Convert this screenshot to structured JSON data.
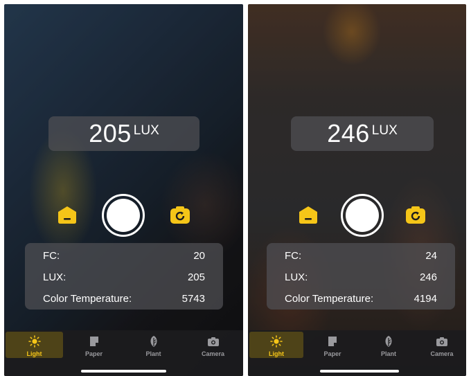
{
  "screens": [
    {
      "lux_display": {
        "value": "205",
        "unit": "LUX"
      },
      "stats": {
        "fc": {
          "label": "FC:",
          "value": "20"
        },
        "lux": {
          "label": "LUX:",
          "value": "205"
        },
        "color_temp": {
          "label": "Color Temperature:",
          "value": "5743"
        }
      }
    },
    {
      "lux_display": {
        "value": "246",
        "unit": "LUX"
      },
      "stats": {
        "fc": {
          "label": "FC:",
          "value": "24"
        },
        "lux": {
          "label": "LUX:",
          "value": "246"
        },
        "color_temp": {
          "label": "Color Temperature:",
          "value": "4194"
        }
      }
    }
  ],
  "tabs": [
    {
      "label": "Light",
      "icon": "sun-icon",
      "active": true
    },
    {
      "label": "Paper",
      "icon": "paper-icon",
      "active": false
    },
    {
      "label": "Plant",
      "icon": "leaf-icon",
      "active": false
    },
    {
      "label": "Camera",
      "icon": "camera-icon",
      "active": false
    }
  ],
  "side_buttons": {
    "left_icon": "home-sensor-icon",
    "right_icon": "switch-camera-icon"
  },
  "colors": {
    "accent": "#f5c518",
    "panel": "#505054",
    "tab_inactive": "#9a9a9e"
  }
}
